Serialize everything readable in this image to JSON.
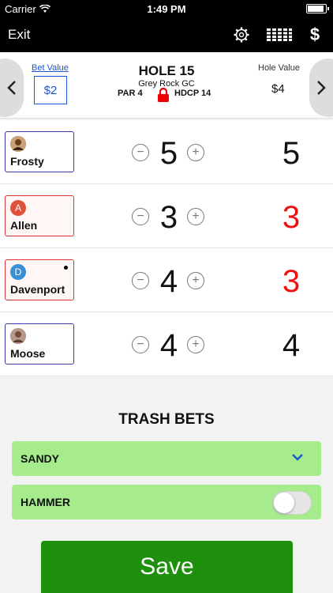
{
  "status_bar": {
    "carrier": "Carrier",
    "time": "1:49 PM"
  },
  "nav": {
    "exit_label": "Exit",
    "icons": [
      "gear-icon",
      "scorecard-grid-icon",
      "dollar-icon"
    ],
    "dollar_glyph": "$"
  },
  "hole": {
    "bet_label": "Bet Value",
    "bet_value": "$2",
    "title": "HOLE 15",
    "course": "Grey Rock GC",
    "par": "PAR 4",
    "hdcp": "HDCP 14",
    "hole_value_label": "Hole Value",
    "hole_value": "$4"
  },
  "players": [
    {
      "name": "Frosty",
      "avatar_initial": "",
      "avatar_color": "#8a5a2b",
      "card_style": "blue",
      "gross": "5",
      "net": "5",
      "net_red": false,
      "marked": false
    },
    {
      "name": "Allen",
      "avatar_initial": "A",
      "avatar_color": "#e0513c",
      "card_style": "red",
      "gross": "3",
      "net": "3",
      "net_red": true,
      "marked": false
    },
    {
      "name": "Davenport",
      "avatar_initial": "D",
      "avatar_color": "#3a8fd6",
      "card_style": "red",
      "gross": "4",
      "net": "3",
      "net_red": true,
      "marked": true
    },
    {
      "name": "Moose",
      "avatar_initial": "",
      "avatar_color": "#8a6a5a",
      "card_style": "blue",
      "gross": "4",
      "net": "4",
      "net_red": false,
      "marked": false
    }
  ],
  "stepper": {
    "minus": "−",
    "plus": "+"
  },
  "trash": {
    "title": "TRASH BETS",
    "items": [
      {
        "label": "SANDY",
        "control": "dropdown"
      },
      {
        "label": "HAMMER",
        "control": "toggle",
        "on": false
      }
    ]
  },
  "save_label": "Save",
  "colors": {
    "accent_blue": "#1a57d6",
    "red": "#e11111",
    "green_button": "#1f8f0e",
    "trash_green": "#a6ec8c"
  }
}
